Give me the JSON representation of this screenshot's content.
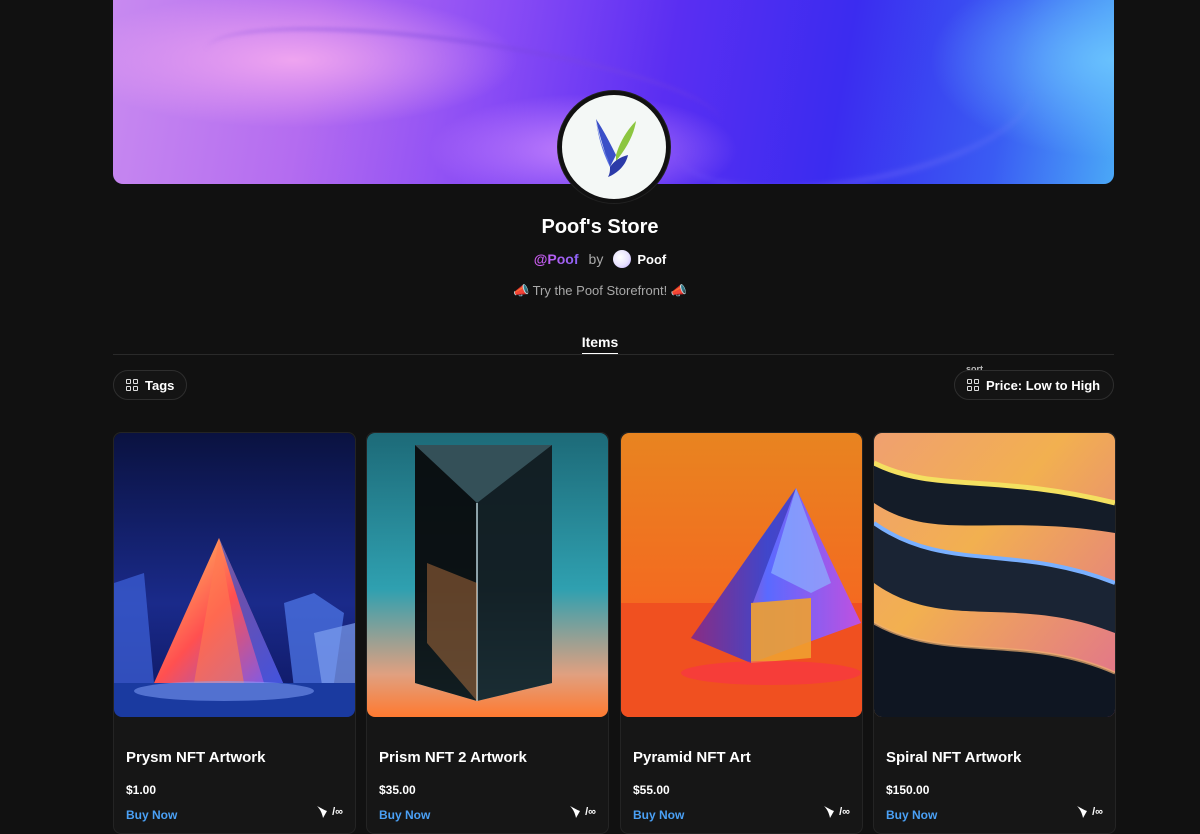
{
  "store": {
    "title": "Poof's Store",
    "handle": "@Poof",
    "by_text": "by",
    "owner_name": "Poof",
    "tagline": "📣 Try the Poof Storefront! 📣"
  },
  "tabs": [
    {
      "label": "Items",
      "active": true
    }
  ],
  "filters": {
    "tags_label": "Tags",
    "sort_caption": "sort",
    "sort_value": "Price: Low to High"
  },
  "items": [
    {
      "title": "Prysm NFT Artwork",
      "price": "$1.00",
      "buy_label": "Buy Now",
      "supply": "/∞"
    },
    {
      "title": "Prism NFT 2 Artwork",
      "price": "$35.00",
      "buy_label": "Buy Now",
      "supply": "/∞"
    },
    {
      "title": "Pyramid NFT Art",
      "price": "$55.00",
      "buy_label": "Buy Now",
      "supply": "/∞"
    },
    {
      "title": "Spiral NFT Artwork",
      "price": "$150.00",
      "buy_label": "Buy Now",
      "supply": "/∞"
    }
  ],
  "colors": {
    "background": "#111111",
    "link_blue": "#4aa0f5",
    "handle_gradient_start": "#d25cf0",
    "handle_gradient_end": "#8a63f5"
  },
  "icons": [
    "poof-logo-icon",
    "grid-icon",
    "megaphone-icon",
    "poof-mark-icon"
  ]
}
